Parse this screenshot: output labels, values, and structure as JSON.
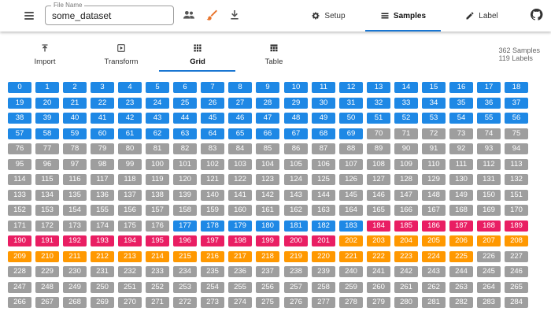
{
  "appbar": {
    "file_name_label": "File Name",
    "file_name_value": "some_dataset",
    "tabs": [
      {
        "label": "Setup",
        "icon": "gear-icon"
      },
      {
        "label": "Samples",
        "icon": "list-icon"
      },
      {
        "label": "Label",
        "icon": "pencil-icon"
      }
    ],
    "active_tab": "Samples",
    "icons": [
      "menu-icon",
      "users-icon",
      "brush-icon",
      "download-icon",
      "github-icon"
    ]
  },
  "subtabs": [
    {
      "label": "Import",
      "icon": "import-icon"
    },
    {
      "label": "Transform",
      "icon": "transform-icon"
    },
    {
      "label": "Grid",
      "icon": "grid-icon"
    },
    {
      "label": "Table",
      "icon": "table-icon"
    }
  ],
  "active_subtab": "Grid",
  "counts": {
    "samples": "362 Samples",
    "labels": "119 Labels"
  },
  "colors": {
    "blue": "#1e88e5",
    "gray": "#9e9e9e",
    "pink": "#e91e63",
    "orange": "#ff9800",
    "accent": "#1976d2",
    "brush": "#e8732b"
  },
  "grid": {
    "columns": 19,
    "total_visible": 285,
    "color_ranges": [
      {
        "from": 0,
        "to": 69,
        "color": "blue"
      },
      {
        "from": 70,
        "to": 176,
        "color": "gray"
      },
      {
        "from": 177,
        "to": 183,
        "color": "blue"
      },
      {
        "from": 184,
        "to": 201,
        "color": "pink"
      },
      {
        "from": 202,
        "to": 225,
        "color": "orange"
      },
      {
        "from": 226,
        "to": 284,
        "color": "gray"
      }
    ]
  }
}
